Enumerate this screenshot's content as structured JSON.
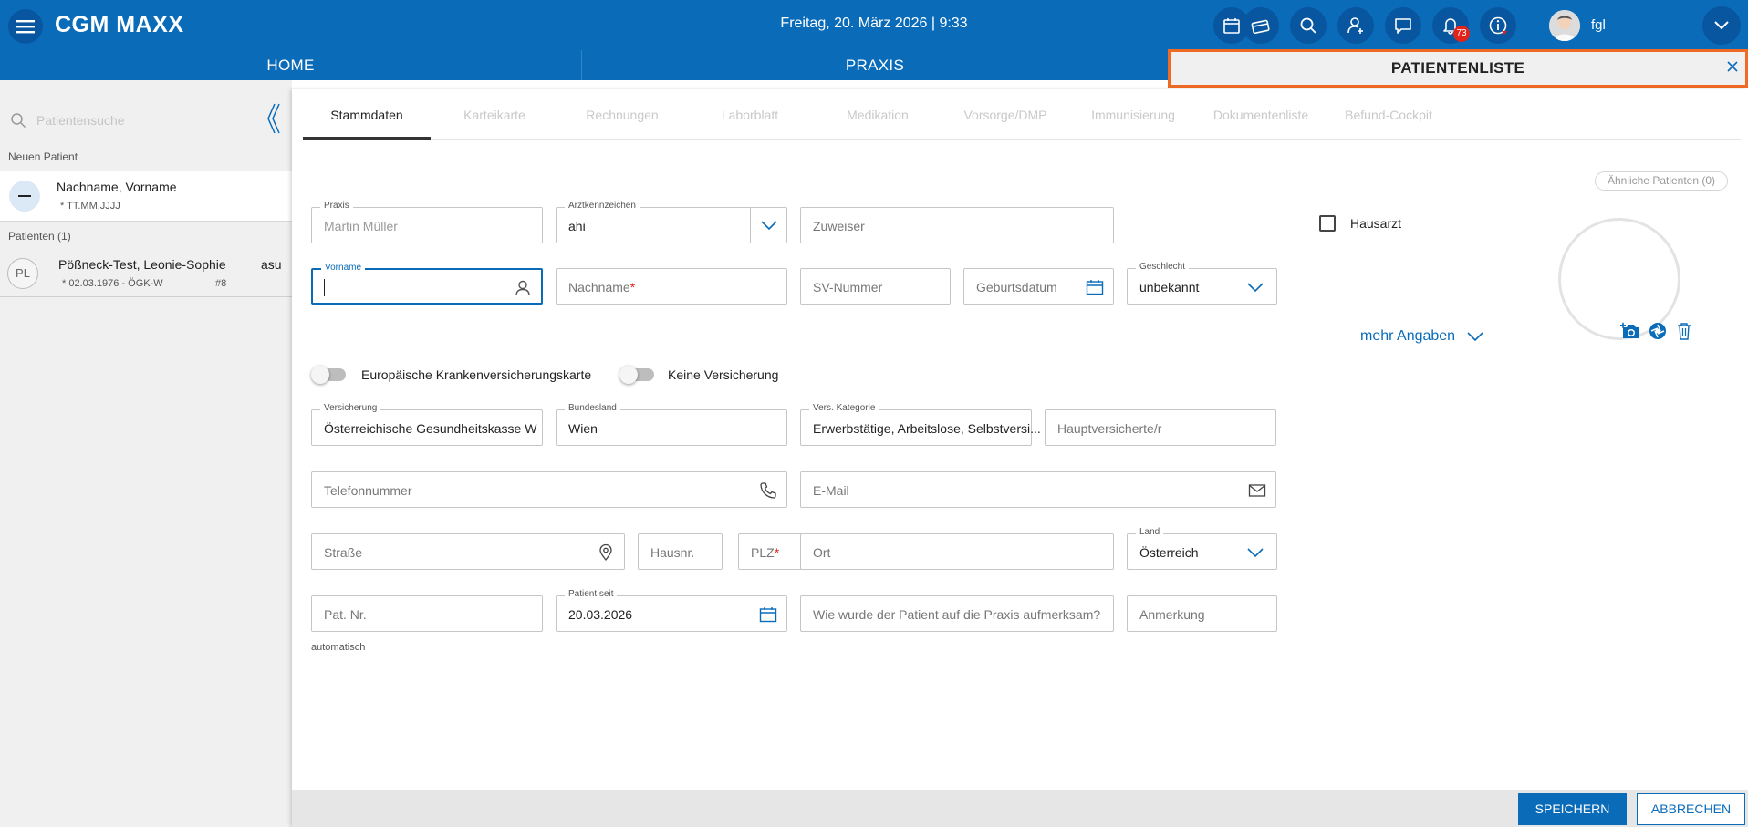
{
  "app": {
    "logo": "CGM MAXX",
    "datetime": "Freitag, 20. März 2026 | 9:33",
    "notifications_count": "73",
    "username": "fgl"
  },
  "nav": {
    "tabs": [
      {
        "label": "HOME"
      },
      {
        "label": "PRAXIS"
      },
      {
        "label": "PATIENTENLISTE"
      }
    ]
  },
  "sidebar": {
    "search_placeholder": "Patientensuche",
    "new_patient_section": "Neuen Patient",
    "new_patient": {
      "name": "Nachname, Vorname",
      "dob": "* TT.MM.JJJJ"
    },
    "patients_section": "Patienten (1)",
    "patients": [
      {
        "initials": "PL",
        "name": "Pößneck-Test, Leonie-Sophie",
        "sub": "* 02.03.1976  - ÖGK-W",
        "number": "#8",
        "tag": "asu"
      }
    ]
  },
  "subtabs": [
    {
      "label": "Stammdaten"
    },
    {
      "label": "Karteikarte"
    },
    {
      "label": "Rechnungen"
    },
    {
      "label": "Laborblatt"
    },
    {
      "label": "Medikation"
    },
    {
      "label": "Vorsorge/DMP"
    },
    {
      "label": "Immunisierung"
    },
    {
      "label": "Dokumentenliste"
    },
    {
      "label": "Befund-Cockpit"
    }
  ],
  "similar_patients": "Ähnliche Patienten (0)",
  "form": {
    "praxis": {
      "label": "Praxis",
      "value": "Martin Müller"
    },
    "arztkennzeichen": {
      "label": "Arztkennzeichen",
      "value": "ahi"
    },
    "zuweiser": {
      "placeholder": "Zuweiser"
    },
    "hausarzt": {
      "label": "Hausarzt"
    },
    "vorname": {
      "label": "Vorname"
    },
    "nachname": {
      "placeholder": "Nachname",
      "required_mark": "*"
    },
    "sv_nummer": {
      "placeholder": "SV-Nummer"
    },
    "geburtsdatum": {
      "placeholder": "Geburtsdatum"
    },
    "geschlecht": {
      "label": "Geschlecht",
      "value": "unbekannt"
    },
    "mehr_angaben": "mehr Angaben",
    "ekvk": {
      "label": "Europäische Krankenversicherungskarte"
    },
    "keine_versicherung": {
      "label": "Keine Versicherung"
    },
    "versicherung": {
      "label": "Versicherung",
      "value": "Österreichische Gesundheitskasse W"
    },
    "bundesland": {
      "label": "Bundesland",
      "value": "Wien"
    },
    "vers_kategorie": {
      "label": "Vers. Kategorie",
      "value": "Erwerbstätige, Arbeitslose, Selbstversi..."
    },
    "hauptversicherte": {
      "placeholder": "Hauptversicherte/r"
    },
    "telefon": {
      "placeholder": "Telefonnummer"
    },
    "email": {
      "placeholder": "E-Mail"
    },
    "strasse": {
      "placeholder": "Straße"
    },
    "hausnr": {
      "placeholder": "Hausnr."
    },
    "plz": {
      "placeholder": "PLZ",
      "required_mark": "*"
    },
    "ort": {
      "placeholder": "Ort"
    },
    "land": {
      "label": "Land",
      "value": "Österreich"
    },
    "pat_nr": {
      "placeholder": "Pat. Nr.",
      "hint": "automatisch"
    },
    "patient_seit": {
      "label": "Patient seit",
      "value": "20.03.2026"
    },
    "aufmerksam": {
      "placeholder": "Wie wurde der Patient auf die Praxis aufmerksam?"
    },
    "anmerkung": {
      "placeholder": "Anmerkung"
    }
  },
  "footer": {
    "save": "SPEICHERN",
    "cancel": "ABBRECHEN"
  },
  "colors": {
    "primary": "#0a6bb9",
    "highlight": "#ee6a25",
    "badge": "#e2231a"
  }
}
